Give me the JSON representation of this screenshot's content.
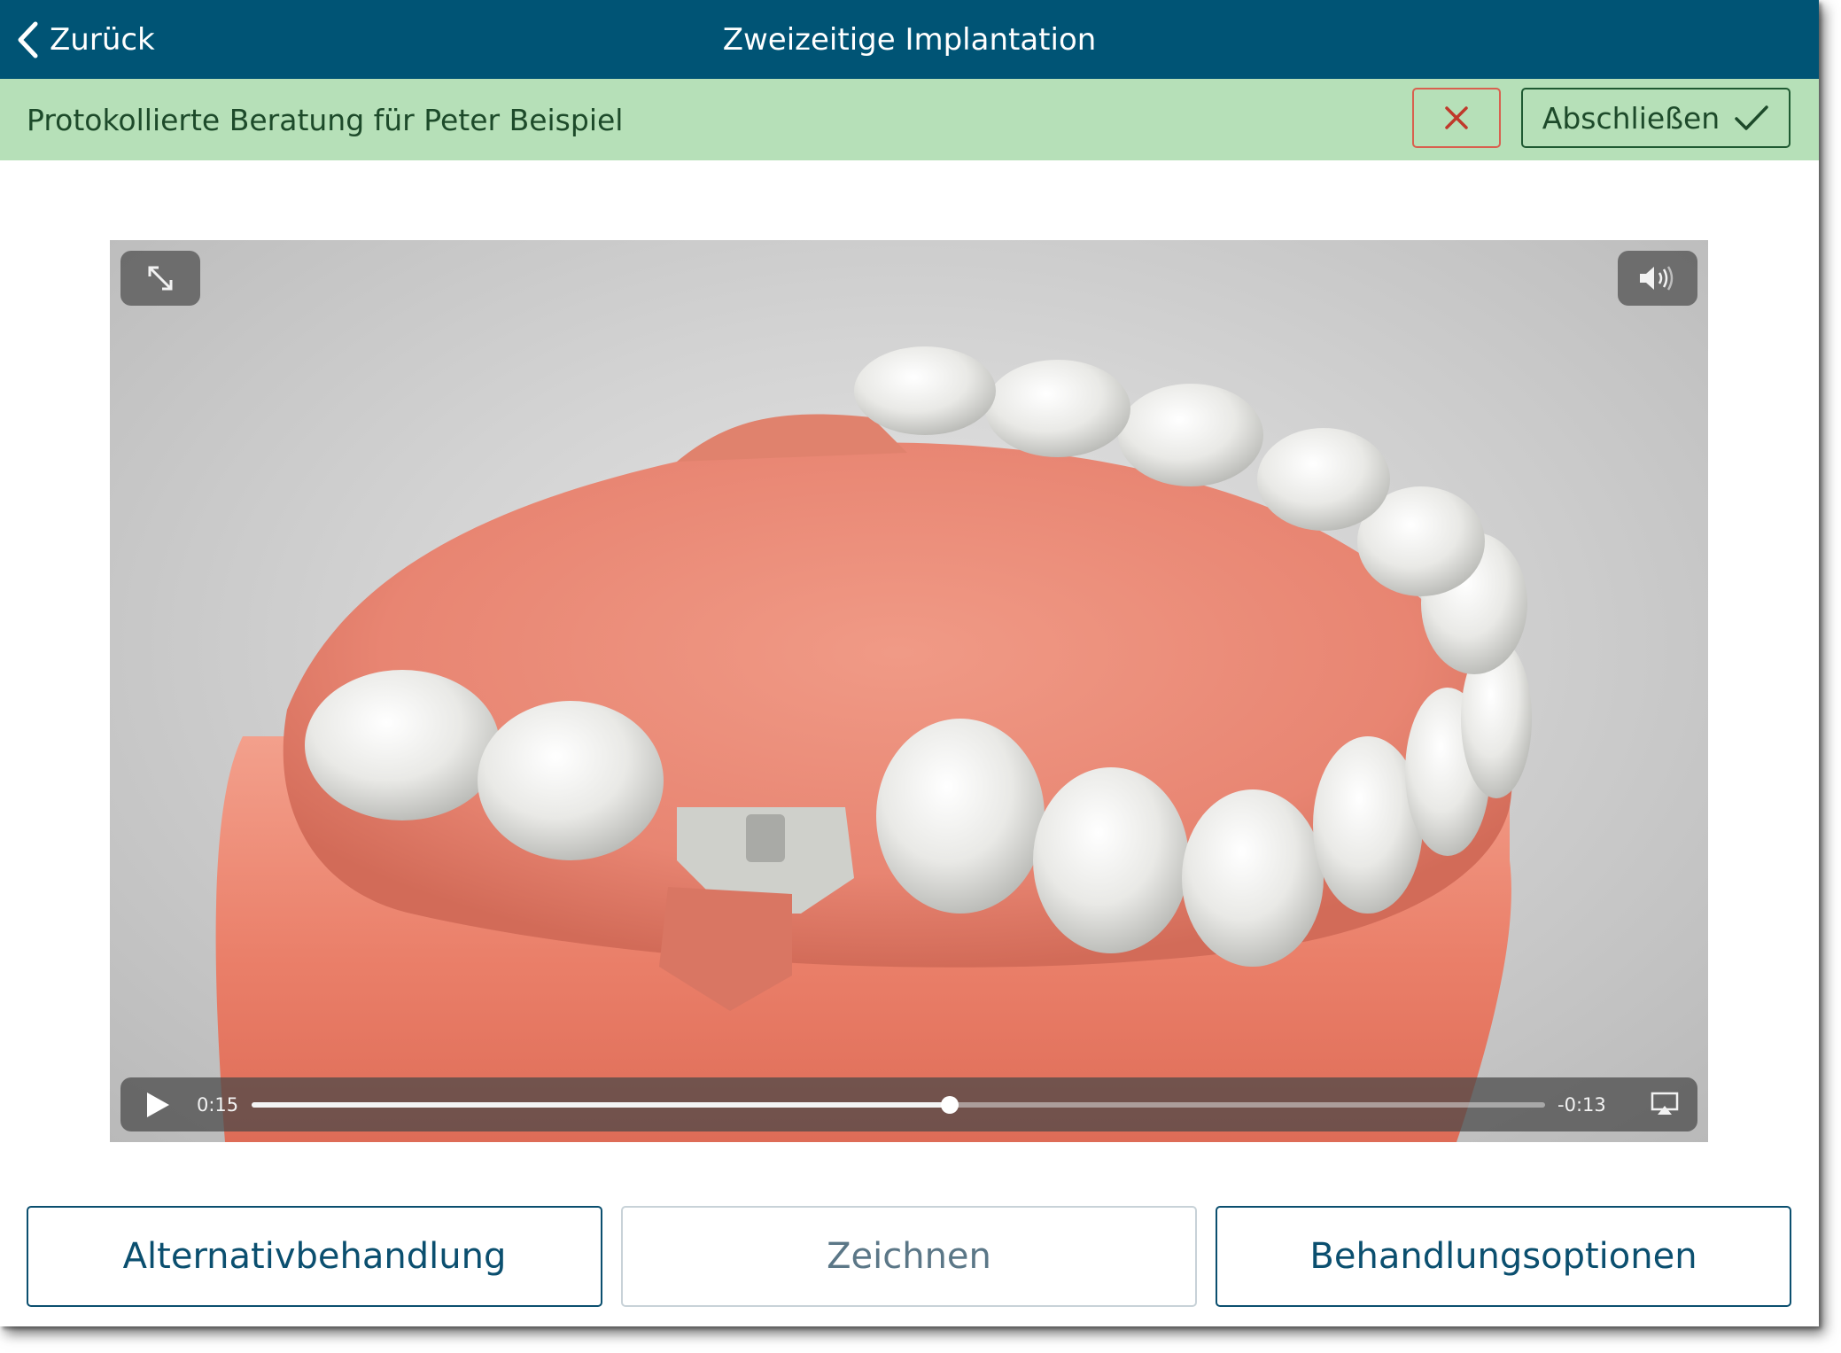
{
  "navbar": {
    "back_label": "Zurück",
    "title": "Zweizeitige Implantation",
    "background_color": "#005475"
  },
  "consultation": {
    "text": "Protokollierte Beratung für Peter Beispiel",
    "finish_label": "Abschließen",
    "cancel_icon": "close-icon",
    "finish_icon": "checkmark-icon",
    "background_color": "#b6e0b8"
  },
  "video": {
    "elapsed": "0:15",
    "remaining": "-0:13",
    "progress_fraction": 0.54,
    "icons": [
      "fullscreen-icon",
      "volume-icon",
      "play-icon",
      "airplay-icon"
    ]
  },
  "actions": {
    "alternative_label": "Alternativbehandlung",
    "draw_label": "Zeichnen",
    "options_label": "Behandlungsoptionen"
  }
}
